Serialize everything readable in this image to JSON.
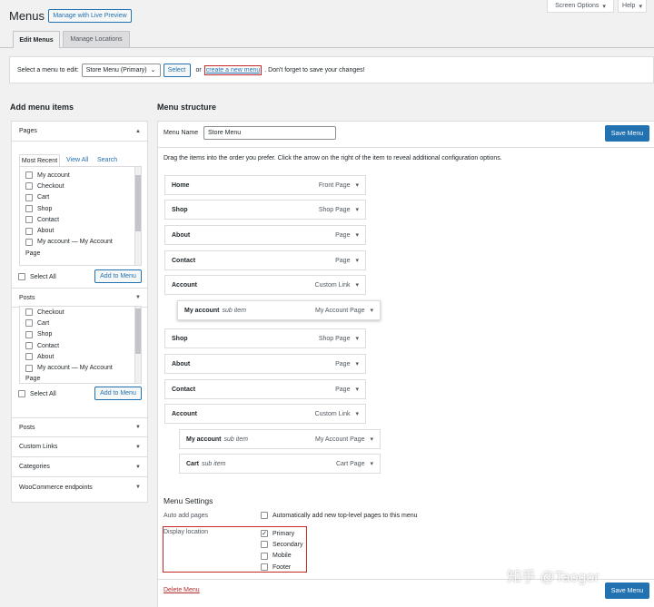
{
  "header": {
    "title": "Menus",
    "live_preview": "Manage with Live Preview",
    "screen_options": "Screen Options",
    "help": "Help"
  },
  "tabs": [
    {
      "label": "Edit Menus"
    },
    {
      "label": "Manage Locations"
    }
  ],
  "select_bar": {
    "prompt": "Select a menu to edit:",
    "selected": "Store Menu (Primary)",
    "select_btn": "Select",
    "or": "or",
    "create_link": "create a new menu",
    "reminder": ". Don't forget to save your changes!"
  },
  "add_items": {
    "title": "Add menu items",
    "pages": {
      "title": "Pages",
      "tabs": [
        "Most Recent",
        "View All",
        "Search"
      ],
      "items": [
        "My account",
        "Checkout",
        "Cart",
        "Shop",
        "Contact",
        "About",
        "My account — My Account",
        "Page"
      ],
      "select_all": "Select All",
      "add_btn": "Add to Menu"
    },
    "posts": {
      "title": "Posts",
      "items": [
        "Checkout",
        "Cart",
        "Shop",
        "Contact",
        "About",
        "My account — My Account",
        "Page"
      ],
      "select_all": "Select All",
      "add_btn": "Add to Menu"
    },
    "collapsed": [
      "Posts",
      "Custom Links",
      "Categories",
      "WooCommerce endpoints"
    ]
  },
  "structure": {
    "title": "Menu structure",
    "name_label": "Menu Name",
    "name_value": "Store Menu",
    "save": "Save Menu",
    "instructions": "Drag the items into the order you prefer. Click the arrow on the right of the item to reveal additional configuration options.",
    "items_a": [
      {
        "name": "Home",
        "type": "Front Page"
      },
      {
        "name": "Shop",
        "type": "Shop Page"
      },
      {
        "name": "About",
        "type": "Page"
      },
      {
        "name": "Contact",
        "type": "Page"
      },
      {
        "name": "Account",
        "type": "Custom Link"
      }
    ],
    "dragging": {
      "name": "My account",
      "sub": "sub item",
      "type": "My Account Page"
    },
    "items_b": [
      {
        "name": "Shop",
        "type": "Shop Page"
      },
      {
        "name": "About",
        "type": "Page"
      },
      {
        "name": "Contact",
        "type": "Page"
      },
      {
        "name": "Account",
        "type": "Custom Link"
      }
    ],
    "sub_items": [
      {
        "name": "My account",
        "sub": "sub item",
        "type": "My Account Page"
      },
      {
        "name": "Cart",
        "sub": "sub item",
        "type": "Cart Page"
      }
    ]
  },
  "settings": {
    "title": "Menu Settings",
    "auto_label": "Auto add pages",
    "auto_text": "Automatically add new top-level pages to this menu",
    "display_label": "Display location",
    "locations": [
      {
        "label": "Primary",
        "checked": true
      },
      {
        "label": "Secondary",
        "checked": false
      },
      {
        "label": "Mobile",
        "checked": false
      },
      {
        "label": "Footer",
        "checked": false
      }
    ],
    "delete": "Delete Menu",
    "save": "Save Menu"
  },
  "watermark": "知乎 @Taogor"
}
